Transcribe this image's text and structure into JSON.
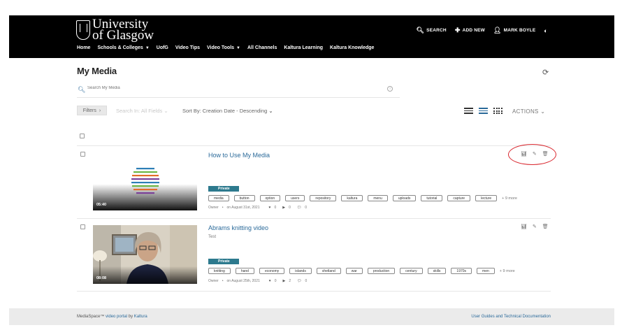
{
  "header": {
    "logo_line1": "University",
    "logo_line2": "of Glasgow",
    "search_label": "SEARCH",
    "add_new_label": "ADD NEW",
    "user_label": "MARK BOYLE",
    "nav": [
      {
        "label": "Home",
        "has_dropdown": false
      },
      {
        "label": "Schools & Colleges",
        "has_dropdown": true
      },
      {
        "label": "UofG",
        "has_dropdown": false
      },
      {
        "label": "Video Tips",
        "has_dropdown": false
      },
      {
        "label": "Video Tools",
        "has_dropdown": true
      },
      {
        "label": "All Channels",
        "has_dropdown": false
      },
      {
        "label": "Kaltura Learning",
        "has_dropdown": false
      },
      {
        "label": "Kaltura Knowledge",
        "has_dropdown": false
      }
    ]
  },
  "page": {
    "title": "My Media",
    "search_placeholder": "Search My Media",
    "filters_label": "Filters",
    "search_in": "Search In: All Fields",
    "sort_by": "Sort By: Creation Date - Descending",
    "actions_label": "ACTIONS"
  },
  "entries": [
    {
      "title": "How to Use My Media",
      "description": "",
      "duration": "05:40",
      "status": "Private",
      "tags": [
        "media",
        "button",
        "option",
        "users",
        "repository",
        "kaltura",
        "menu",
        "uploads",
        "tutorial",
        "capture",
        "lecture"
      ],
      "more": "+ 9 more",
      "owner": "Owner",
      "date": "on August 31st, 2021",
      "likes": "0",
      "plays": "0",
      "comments": "0"
    },
    {
      "title": "Abrams knitting video",
      "description": "Test",
      "duration": "08:08",
      "status": "Private",
      "tags": [
        "knitting",
        "hand",
        "economy",
        "islands",
        "shetland",
        "war",
        "production",
        "century",
        "skills",
        "1970s",
        "men"
      ],
      "more": "+ 9 more",
      "owner": "Owner",
      "date": "on August 25th, 2021",
      "likes": "0",
      "plays": "2",
      "comments": "0"
    }
  ],
  "footer": {
    "product": "MediaSpace™",
    "portal_link": "video portal",
    "by": "by",
    "vendor_link": "Kaltura",
    "docs_link": "User Guides and Technical Documentation"
  },
  "colors": {
    "header_bg": "#000000",
    "accent": "#2b6a9a",
    "badge": "#2d7a8e",
    "highlight_ellipse": "#d9272e",
    "footer_bg": "#ebebeb"
  },
  "icons": [
    "search-icon",
    "plus-icon",
    "user-icon",
    "contrast-icon",
    "refresh-icon",
    "info-icon",
    "chevron-right-icon",
    "chevron-down-icon",
    "details-view-icon",
    "list-view-icon",
    "grid-view-icon",
    "analytics-icon",
    "edit-icon",
    "delete-icon",
    "heart-icon",
    "play-icon",
    "comment-icon"
  ]
}
